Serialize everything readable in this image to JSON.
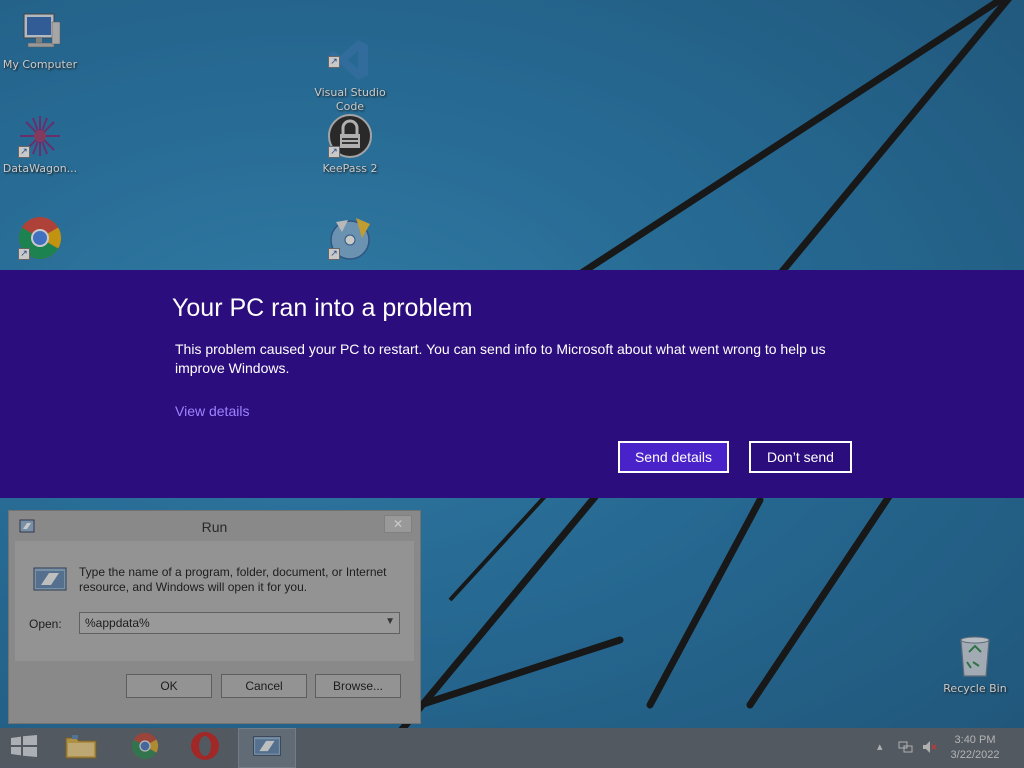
{
  "desktop": {
    "icons": [
      {
        "label": "My Computer"
      },
      {
        "label": "Visual Studio\nCode"
      },
      {
        "label": "DataWagon..."
      },
      {
        "label": "KeePass 2"
      },
      {
        "label": "Chrome"
      },
      {
        "label": "DVD Player"
      },
      {
        "label": "Recycle Bin"
      }
    ]
  },
  "error_banner": {
    "title": "Your PC ran into a problem",
    "message": "This problem caused your PC to restart. You can send info to Microsoft about what went wrong to help us improve Windows.",
    "link": "View details",
    "send_label": "Send details",
    "dont_send_label": "Don’t send",
    "background": "#2c0d7d",
    "accent": "#4a22c9"
  },
  "run_dialog": {
    "title": "Run",
    "close_glyph": "✕",
    "description": "Type the name of a program, folder, document, or Internet resource, and Windows will open it for you.",
    "open_label": "Open:",
    "open_value": "%appdata%",
    "ok_label": "OK",
    "cancel_label": "Cancel",
    "browse_label": "Browse..."
  },
  "taskbar": {
    "items": [
      "start-icon",
      "file-explorer-icon",
      "chrome-icon",
      "opera-icon",
      "run-icon"
    ],
    "tray": {
      "show_hidden": "▴"
    },
    "time": "3:40 PM",
    "date": "3/22/2022"
  }
}
